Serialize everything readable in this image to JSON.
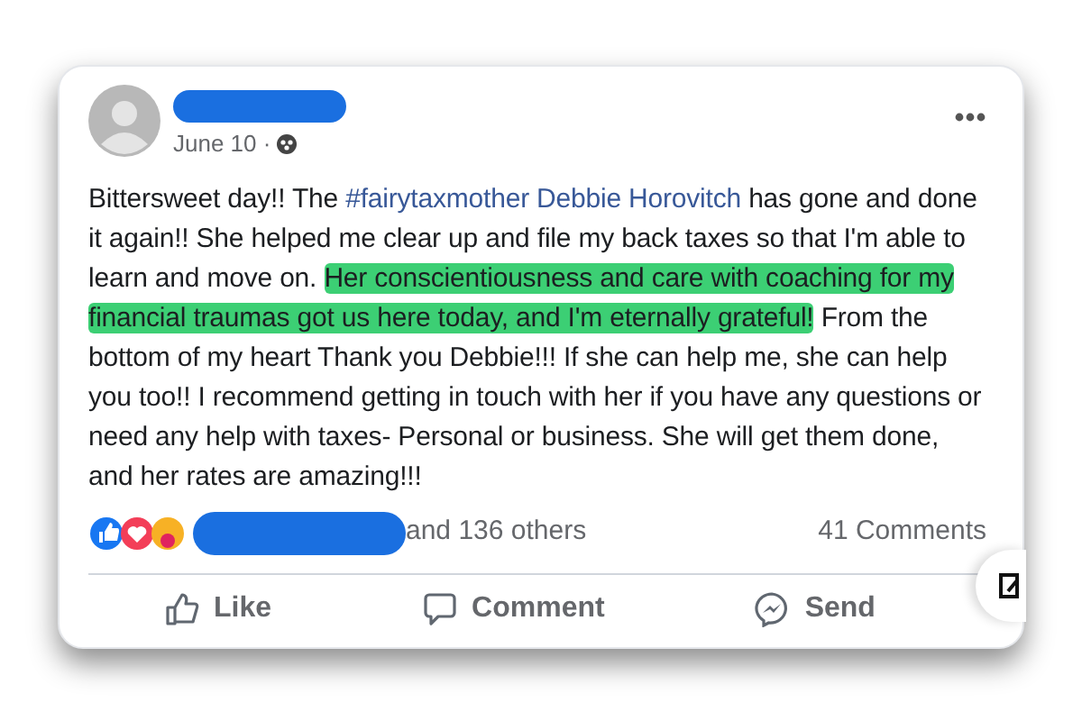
{
  "post": {
    "date": "June 10 ·",
    "body": [
      {
        "kind": "text",
        "text": "Bittersweet day!! The "
      },
      {
        "kind": "link",
        "text": "#fairytaxmother Debbie Horovitch"
      },
      {
        "kind": "text",
        "text": " has gone and done it again!! She helped me clear up and file my back taxes so that I'm able to learn and move on. "
      },
      {
        "kind": "highlight",
        "text": "Her conscientiousness and care with coaching for my financial traumas got us here today, and I'm eternally grateful!"
      },
      {
        "kind": "text",
        "text": " From the bottom of my heart Thank you Debbie!!! If she can help me, she can  help you too!!  I recommend getting in touch with her if you have any questions or need any help with taxes- Personal or business. She will get them done, and her rates are amazing!!!"
      }
    ],
    "reactions_text": "and 136 others",
    "comments": "41 Comments",
    "actions": [
      {
        "kind": "like",
        "label": "Like"
      },
      {
        "kind": "comment",
        "label": "Comment"
      },
      {
        "kind": "send",
        "label": "Send"
      }
    ]
  }
}
